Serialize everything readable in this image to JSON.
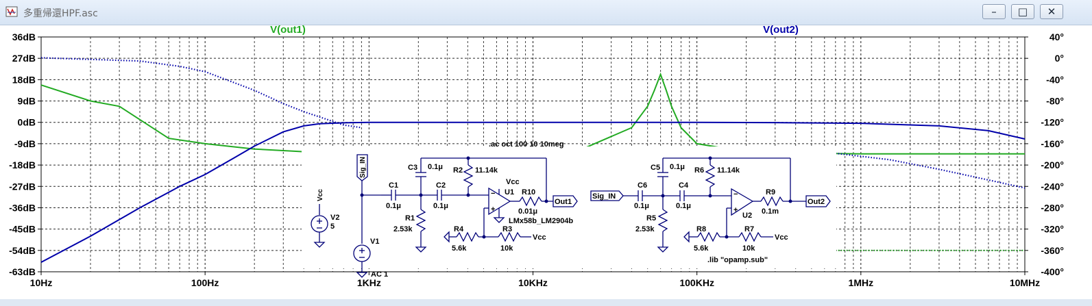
{
  "window": {
    "title": "多重帰還HPF.asc",
    "minimize_icon": "minimize-icon",
    "maximize_icon": "maximize-icon",
    "close_icon": "close-icon"
  },
  "colors": {
    "out1": "#22aa22",
    "out2": "#0000aa",
    "grid": "#000000",
    "schematic": "#000077"
  },
  "chart_data": {
    "type": "line",
    "xscale": "log",
    "xlim": [
      10,
      10000000
    ],
    "x_ticks": [
      "10Hz",
      "100Hz",
      "1KHz",
      "10KHz",
      "100KHz",
      "1MHz",
      "10MHz"
    ],
    "ylim_left": [
      -63,
      36
    ],
    "y_ticks_left": [
      "36dB",
      "27dB",
      "18dB",
      "9dB",
      "0dB",
      "-9dB",
      "-18dB",
      "-27dB",
      "-36dB",
      "-45dB",
      "-54dB",
      "-63dB"
    ],
    "ylim_right": [
      -400,
      40
    ],
    "y_ticks_right": [
      "40°",
      "0°",
      "-40°",
      "-80°",
      "-120°",
      "-160°",
      "-200°",
      "-240°",
      "-280°",
      "-320°",
      "-360°",
      "-400°"
    ],
    "grid": true,
    "series": [
      {
        "name": "V(out1)",
        "magnitude_db": [
          [
            10,
            -50
          ],
          [
            20,
            -80
          ],
          [
            30,
            -90
          ],
          [
            60,
            -150
          ],
          [
            100,
            -160
          ],
          [
            200,
            -170
          ],
          [
            400,
            -175
          ],
          [
            600,
            -177
          ],
          [
            1000,
            -178
          ],
          [
            5000,
            -179
          ],
          [
            10000,
            -178
          ],
          [
            20000,
            -170
          ],
          [
            40000,
            -130
          ],
          [
            50000,
            -90
          ],
          [
            55000,
            -60
          ],
          [
            60000,
            -30
          ],
          [
            65000,
            -60
          ],
          [
            70000,
            -90
          ],
          [
            80000,
            -130
          ],
          [
            100000,
            -160
          ],
          [
            200000,
            -175
          ],
          [
            500000,
            -178
          ],
          [
            1000000,
            -179
          ],
          [
            10000000,
            -179
          ]
        ],
        "phase_deg": [
          [
            700000,
            -360
          ],
          [
            10000000,
            -360
          ]
        ]
      },
      {
        "name": "V(out2)",
        "magnitude_db": [
          [
            10,
            -59
          ],
          [
            20,
            -48
          ],
          [
            40,
            -36
          ],
          [
            70,
            -27
          ],
          [
            100,
            -22
          ],
          [
            150,
            -15
          ],
          [
            200,
            -10
          ],
          [
            300,
            -4
          ],
          [
            400,
            -1.5
          ],
          [
            500,
            -0.6
          ],
          [
            700,
            -0.2
          ],
          [
            1000,
            0
          ],
          [
            10000,
            0
          ],
          [
            100000,
            0
          ],
          [
            300000,
            -0.1
          ],
          [
            1000000,
            -0.4
          ],
          [
            3000000,
            -1.5
          ],
          [
            6000000,
            -3.5
          ],
          [
            10000000,
            -7
          ]
        ],
        "phase_deg": [
          [
            10,
            1
          ],
          [
            40,
            -5
          ],
          [
            70,
            -15
          ],
          [
            100,
            -25
          ],
          [
            200,
            -60
          ],
          [
            300,
            -85
          ],
          [
            400,
            -100
          ],
          [
            500,
            -110
          ],
          [
            700,
            -125
          ],
          [
            900,
            -130
          ],
          [
            700000,
            -178
          ],
          [
            1500000,
            -190
          ],
          [
            3000000,
            -208
          ],
          [
            6000000,
            -228
          ],
          [
            10000000,
            -243
          ]
        ]
      }
    ]
  },
  "schematic": {
    "directive_ac": ".ac oct 100 10 10meg",
    "directive_lib": ".lib \"opamp.sub\"",
    "sig_in_1": "Sig_IN",
    "sig_in_2": "Sig_IN",
    "out1": "Out1",
    "out2": "Out2",
    "vcc_v2": "Vcc",
    "v2": "V2",
    "v2_val": "5",
    "v1": "V1",
    "v1_val": "AC 1",
    "c1": "C1",
    "c1_val": "0.1μ",
    "c2": "C2",
    "c2_val": "0.1μ",
    "c3": "C3",
    "c3_val": "0.1μ",
    "r1": "R1",
    "r1_val": "2.53k",
    "r2": "R2",
    "r2_val": "11.14k",
    "r3": "R3",
    "r3_val": "10k",
    "r4": "R4",
    "r4_val": "5.6k",
    "r10": "R10",
    "r10_val": "0.01μ",
    "u1": "U1",
    "u1_vcc": "Vcc",
    "u1_model": "LMx58b_LM2904b",
    "r3_vcc": "Vcc",
    "c4": "C4",
    "c4_val": "0.1μ",
    "c5": "C5",
    "c5_val": "0.1μ",
    "c6": "C6",
    "c6_val": "0.1μ",
    "r5": "R5",
    "r5_val": "2.53k",
    "r6": "R6",
    "r6_val": "11.14k",
    "r7": "R7",
    "r7_val": "10k",
    "r8": "R8",
    "r8_val": "5.6k",
    "r9": "R9",
    "r9_val": "0.1m",
    "u2": "U2",
    "r7_vcc": "Vcc"
  }
}
